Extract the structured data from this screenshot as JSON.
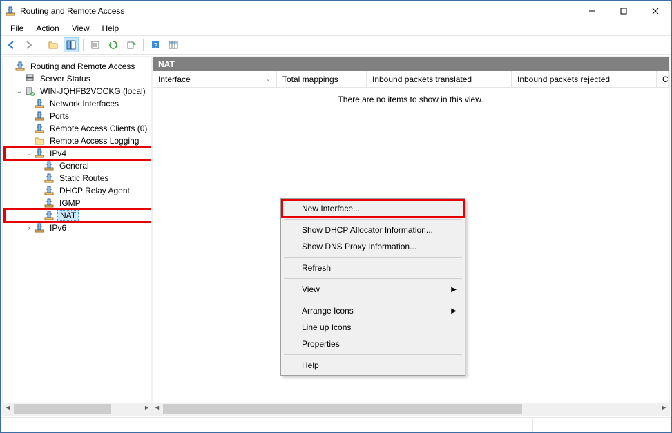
{
  "window": {
    "title": "Routing and Remote Access"
  },
  "menubar": [
    "File",
    "Action",
    "View",
    "Help"
  ],
  "toolbar_icons": [
    "back",
    "forward",
    "up",
    "show-tree",
    "properties",
    "refresh",
    "export",
    "help",
    "columns"
  ],
  "tree": {
    "root": {
      "label": "Routing and Remote Access",
      "children": [
        {
          "label": "Server Status",
          "icon": "server"
        },
        {
          "label": "WIN-JQHFB2VOCKG (local)",
          "icon": "server-green",
          "expanded": true,
          "children": [
            {
              "label": "Network Interfaces",
              "icon": "rras"
            },
            {
              "label": "Ports",
              "icon": "rras"
            },
            {
              "label": "Remote Access Clients (0)",
              "icon": "rras"
            },
            {
              "label": "Remote Access Logging",
              "icon": "folder"
            },
            {
              "label": "IPv4",
              "icon": "rras",
              "expanded": true,
              "highlighted": true,
              "children": [
                {
                  "label": "General",
                  "icon": "rras"
                },
                {
                  "label": "Static Routes",
                  "icon": "rras"
                },
                {
                  "label": "DHCP Relay Agent",
                  "icon": "rras"
                },
                {
                  "label": "IGMP",
                  "icon": "rras"
                },
                {
                  "label": "NAT",
                  "icon": "rras",
                  "selected": true,
                  "highlighted": true
                }
              ]
            },
            {
              "label": "IPv6",
              "icon": "rras",
              "expanded": false
            }
          ]
        }
      ]
    }
  },
  "right": {
    "header": "NAT",
    "columns": [
      "Interface",
      "Total mappings",
      "Inbound packets translated",
      "Inbound packets rejected"
    ],
    "empty_message": "There are no items to show in this view."
  },
  "context_menu": {
    "groups": [
      [
        {
          "label": "New Interface...",
          "highlighted": true
        }
      ],
      [
        {
          "label": "Show DHCP Allocator Information..."
        },
        {
          "label": "Show DNS Proxy Information..."
        }
      ],
      [
        {
          "label": "Refresh"
        }
      ],
      [
        {
          "label": "View",
          "submenu": true
        }
      ],
      [
        {
          "label": "Arrange Icons",
          "submenu": true
        },
        {
          "label": "Line up Icons"
        },
        {
          "label": "Properties"
        }
      ],
      [
        {
          "label": "Help"
        }
      ]
    ]
  }
}
